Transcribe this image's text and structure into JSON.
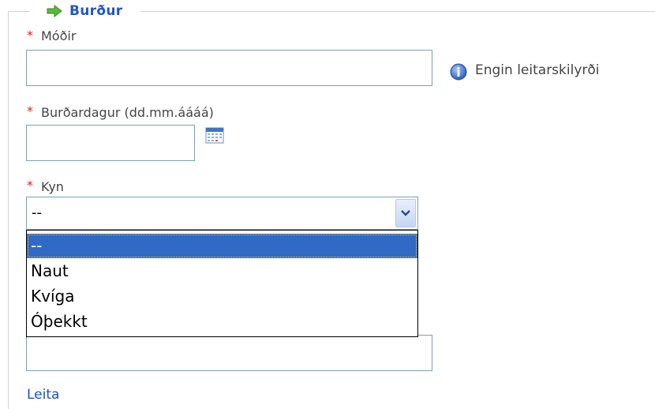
{
  "form": {
    "legend": "Burður",
    "legend_icon": "green-arrow-right-icon",
    "required_marker": "*",
    "modir": {
      "label": "Móðir",
      "value": "",
      "info_icon": "info-icon",
      "info_text": "Engin leitarskilyrði"
    },
    "burdardagur": {
      "label": "Burðardagur (dd.mm.áááá)",
      "value": "",
      "calendar_icon": "calendar-icon"
    },
    "kyn": {
      "label": "Kyn",
      "selected": "--",
      "options": [
        "--",
        "Naut",
        "Kvíga",
        "Óþekkt"
      ],
      "dropdown_icon": "chevron-down-icon"
    },
    "extra_field": {
      "value": ""
    },
    "search_link": "Leita"
  },
  "colors": {
    "legend": "#2255cc",
    "required": "#e02020",
    "link": "#1a4fcf",
    "selected_option": "#316ac5",
    "input_border": "#7f9db9"
  }
}
